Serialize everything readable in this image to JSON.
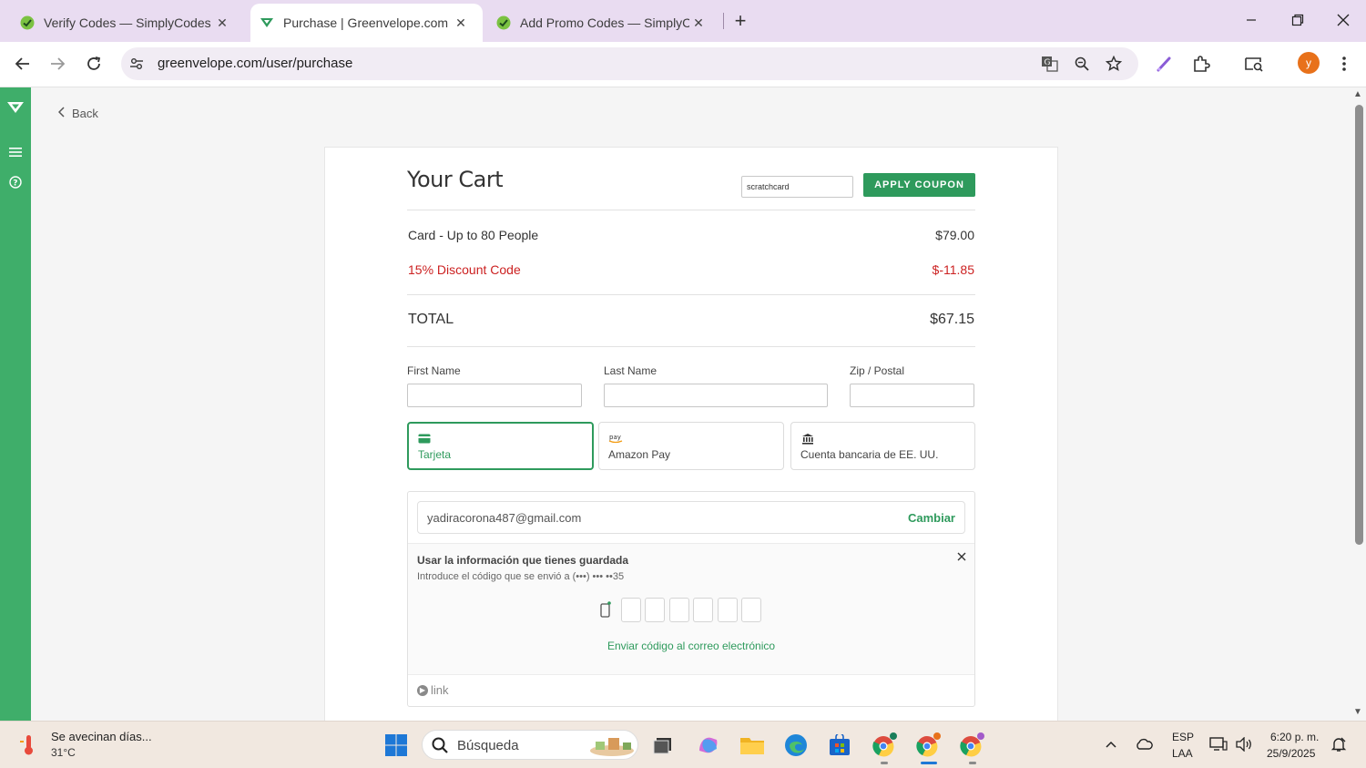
{
  "browser": {
    "tabs": [
      {
        "title": "Verify Codes — SimplyCodes",
        "active": false,
        "favicon": "simplycodes-icon"
      },
      {
        "title": "Purchase | Greenvelope.com",
        "active": true,
        "favicon": "greenvelope-icon"
      },
      {
        "title": "Add Promo Codes — SimplyCodes",
        "active": false,
        "favicon": "simplycodes-icon"
      }
    ],
    "url": "greenvelope.com/user/purchase",
    "profile_initial": "y",
    "colors": {
      "tab_strip": "#e9dcf1",
      "profile": "#e8711a"
    }
  },
  "page": {
    "back_label": "Back",
    "cart_title": "Your Cart",
    "coupon": {
      "value": "scratchcard",
      "button_label": "APPLY COUPON"
    },
    "line_items": [
      {
        "label": "Card - Up to 80 People",
        "amount": "$79.00"
      },
      {
        "label": "15% Discount Code",
        "amount": "$-11.85"
      }
    ],
    "total": {
      "label": "TOTAL",
      "amount": "$67.15"
    },
    "fields": {
      "first_name": "First Name",
      "last_name": "Last Name",
      "zip": "Zip / Postal"
    },
    "payment_options": [
      {
        "label": "Tarjeta",
        "icon": "card-icon",
        "selected": true
      },
      {
        "label": "Amazon Pay",
        "icon": "amazon-pay-icon",
        "selected": false
      },
      {
        "label": "Cuenta bancaria de EE. UU.",
        "icon": "bank-icon",
        "selected": false
      }
    ],
    "link_checkout": {
      "email": "yadiracorona487@gmail.com",
      "change_label": "Cambiar",
      "saved_title": "Usar la información que tienes guardada",
      "saved_subtitle": "Introduce el código que se envió a (•••) ••• ••35",
      "otp_boxes": 6,
      "send_email_label": "Enviar código al correo electrónico",
      "brand_label": "link"
    },
    "accent_color": "#2e9a5c",
    "discount_color": "#cc2222"
  },
  "taskbar": {
    "weather": {
      "title": "Se avecinan días...",
      "temp": "31°C"
    },
    "search_placeholder": "Búsqueda",
    "lang": {
      "code": "ESP",
      "layout": "LAA"
    },
    "time": "6:20 p. m.",
    "date": "25/9/2025"
  }
}
